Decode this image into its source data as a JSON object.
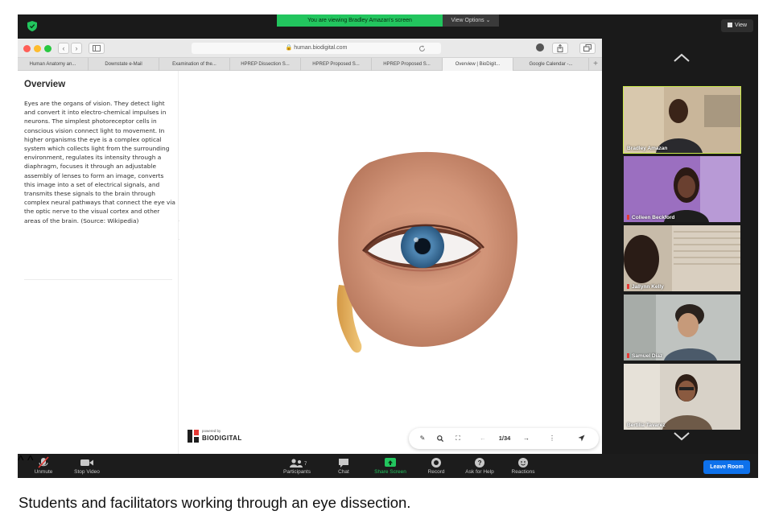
{
  "zoom": {
    "banner_text": "You are viewing Bradley Amazan's screen",
    "view_options_label": "View Options ⌄",
    "view_button_label": "View",
    "colors": {
      "banner": "#22c55e",
      "leave": "#0e71eb",
      "active_speaker": "#c9e84a"
    }
  },
  "browser": {
    "url": "🔒 human.biodigital.com",
    "tabs": [
      "Human Anatomy an...",
      "Downstate e-Mail",
      "Examination of the...",
      "HPREP Dissection S...",
      "HPREP Proposed S...",
      "HPREP Proposed S...",
      "Overview | BioDigit...",
      "Google Calendar -..."
    ],
    "active_tab_index": 6
  },
  "sidebar": {
    "title": "Overview",
    "text": "Eyes are the organs of vision. They detect light and convert it into electro-chemical impulses in neurons. The simplest photoreceptor cells in conscious vision connect light to movement. In higher organisms the eye is a complex optical system which collects light from the surrounding environment, regulates its intensity through a diaphragm, focuses it through an adjustable assembly of lenses to form an image, converts this image into a set of electrical signals, and transmits these signals to the brain through complex neural pathways that connect the eye via the optic nerve to the visual cortex and other areas of the brain. (Source: Wikipedia)"
  },
  "viewer": {
    "logo_powered": "powered by",
    "logo_name": "BIODIGITAL",
    "page_indicator": "1/34"
  },
  "participants": [
    {
      "name": "Bradley Amazan",
      "muted": false,
      "active": true
    },
    {
      "name": "Colleen Beckford",
      "muted": true,
      "active": false
    },
    {
      "name": "Jallynn Kelly",
      "muted": true,
      "active": false
    },
    {
      "name": "Samuel Diaz",
      "muted": true,
      "active": false
    },
    {
      "name": "Bertilia Tavarez",
      "muted": false,
      "active": false
    }
  ],
  "toolbar": {
    "unmute": "Unmute",
    "stop_video": "Stop Video",
    "participants_label": "Participants",
    "participants_count": "7",
    "chat": "Chat",
    "share_screen": "Share Screen",
    "record": "Record",
    "ask_for_help": "Ask for Help",
    "reactions": "Reactions",
    "leave_room": "Leave Room"
  },
  "caption": "Students and facilitators working through an eye dissection."
}
